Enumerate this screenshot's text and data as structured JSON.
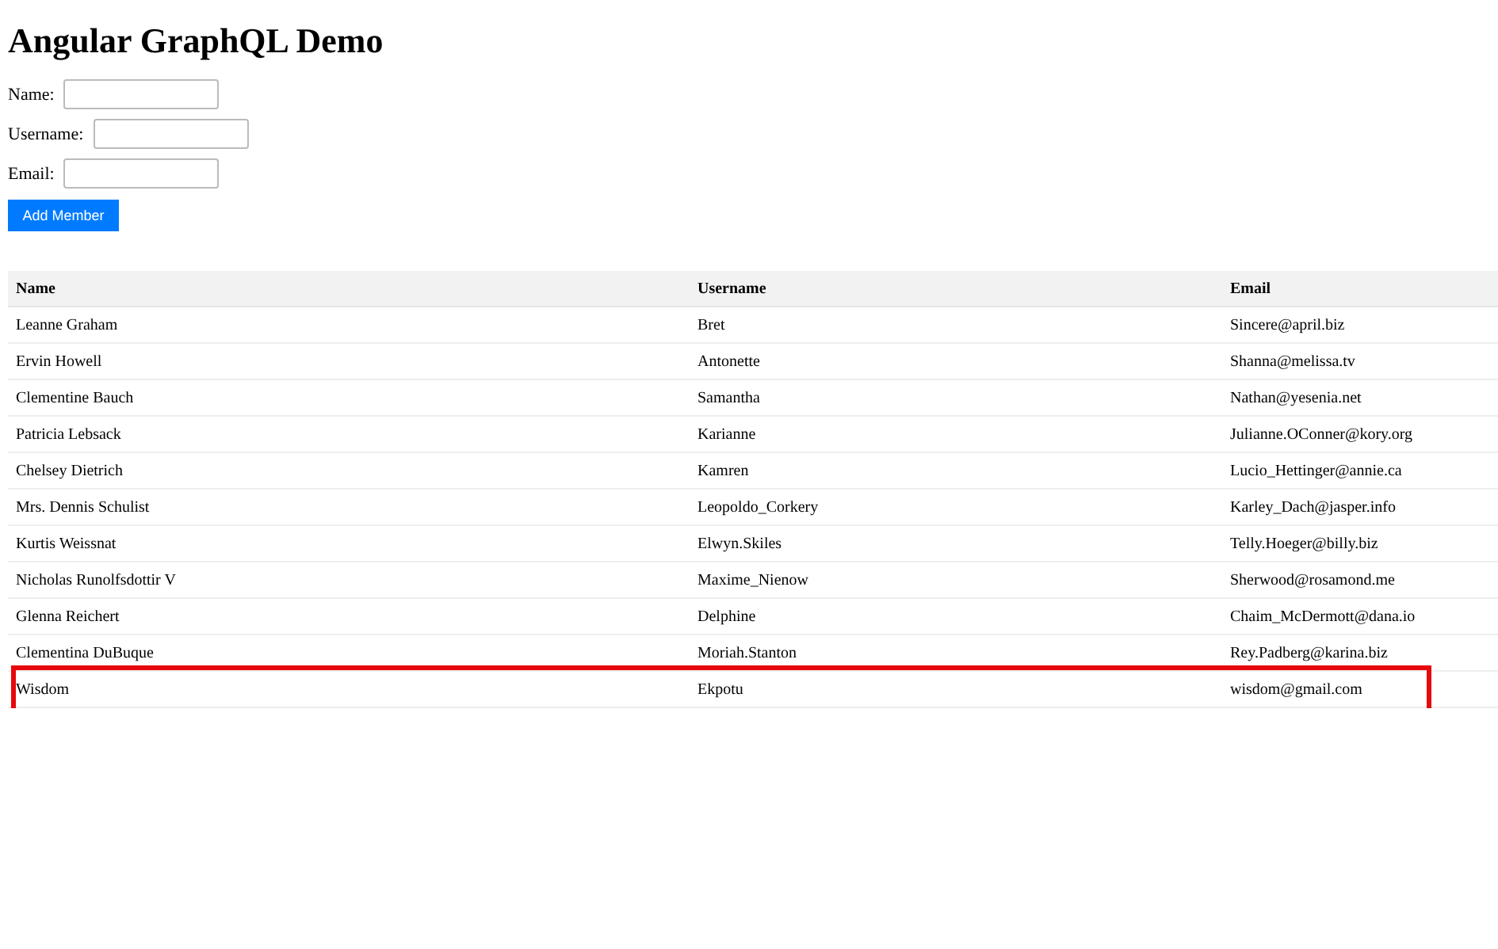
{
  "title": "Angular GraphQL Demo",
  "form": {
    "fields": [
      {
        "label": "Name:"
      },
      {
        "label": "Username:"
      },
      {
        "label": "Email:"
      }
    ],
    "button": "Add Member"
  },
  "table": {
    "columns": [
      "Name",
      "Username",
      "Email"
    ],
    "rows": [
      {
        "cells": [
          "Leanne Graham",
          "Bret",
          "Sincere@april.biz"
        ],
        "highlighted": false
      },
      {
        "cells": [
          "Ervin Howell",
          "Antonette",
          "Shanna@melissa.tv"
        ],
        "highlighted": false
      },
      {
        "cells": [
          "Clementine Bauch",
          "Samantha",
          "Nathan@yesenia.net"
        ],
        "highlighted": false
      },
      {
        "cells": [
          "Patricia Lebsack",
          "Karianne",
          "Julianne.OConner@kory.org"
        ],
        "highlighted": false
      },
      {
        "cells": [
          "Chelsey Dietrich",
          "Kamren",
          "Lucio_Hettinger@annie.ca"
        ],
        "highlighted": false
      },
      {
        "cells": [
          "Mrs. Dennis Schulist",
          "Leopoldo_Corkery",
          "Karley_Dach@jasper.info"
        ],
        "highlighted": false
      },
      {
        "cells": [
          "Kurtis Weissnat",
          "Elwyn.Skiles",
          "Telly.Hoeger@billy.biz"
        ],
        "highlighted": false
      },
      {
        "cells": [
          "Nicholas Runolfsdottir V",
          "Maxime_Nienow",
          "Sherwood@rosamond.me"
        ],
        "highlighted": false
      },
      {
        "cells": [
          "Glenna Reichert",
          "Delphine",
          "Chaim_McDermott@dana.io"
        ],
        "highlighted": false
      },
      {
        "cells": [
          "Clementina DuBuque",
          "Moriah.Stanton",
          "Rey.Padberg@karina.biz"
        ],
        "highlighted": false
      },
      {
        "cells": [
          "Wisdom",
          "Ekpotu",
          "wisdom@gmail.com"
        ],
        "highlighted": true
      }
    ]
  }
}
